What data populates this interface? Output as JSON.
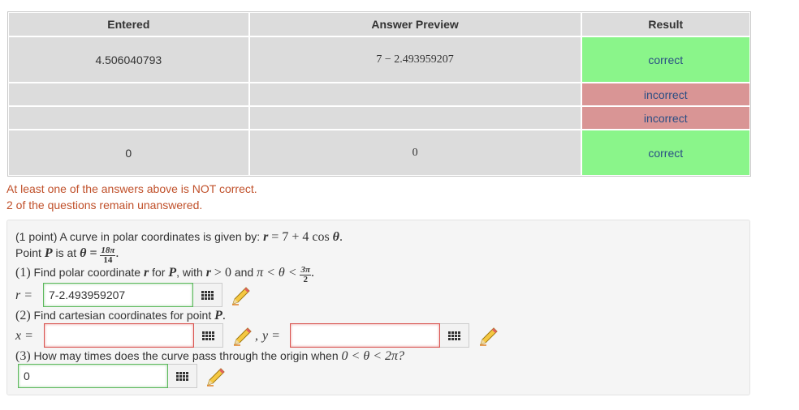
{
  "results": {
    "headers": [
      "Entered",
      "Answer Preview",
      "Result"
    ],
    "rows": [
      {
        "entered": "4.506040793",
        "preview": "7 − 2.493959207",
        "result": "correct"
      },
      {
        "entered": "",
        "preview": "",
        "result": "incorrect"
      },
      {
        "entered": "",
        "preview": "",
        "result": "incorrect"
      },
      {
        "entered": "0",
        "preview": "0",
        "result": "correct"
      }
    ]
  },
  "messages": {
    "not_correct": "At least one of the answers above is NOT correct.",
    "unanswered": "2 of the questions remain unanswered."
  },
  "problem": {
    "intro": "(1 point) A curve in polar coordinates is given by:",
    "r_var": "r",
    "eq1": "= 7 + 4",
    "cos": "cos",
    "theta": "θ",
    "period": ".",
    "point_text": "Point",
    "P": "P",
    "is_at": "is at",
    "theta_eq": "θ =",
    "frac1_num": "18π",
    "frac1_den": "14",
    "q1_num": "(1)",
    "q1_text": "Find polar coordinate",
    "q1_for": "for",
    "q1_with": ", with",
    "q1_cond1": "> 0",
    "q1_and": "and",
    "q1_pi": "π < θ <",
    "frac2_num": "3π",
    "frac2_den": "2",
    "q2_num": "(2)",
    "q2_text": "Find cartesian coordinates for point",
    "q3_num": "(3)",
    "q3_text": "How may times does the curve pass through the origin when",
    "q3_cond": "0 < θ < 2π?",
    "r_label": "r =",
    "x_label": "x =",
    "comma": ",",
    "y_label": "y =",
    "r_value": "7-2.493959207",
    "x_value": "",
    "y_value": "",
    "n_value": "0"
  },
  "colors": {
    "correct": "#8af58a",
    "incorrect": "#d99595",
    "message": "#c0502a"
  },
  "icons": {
    "keyboard": "keyboard-grid-icon",
    "pencil": "pencil-icon"
  }
}
